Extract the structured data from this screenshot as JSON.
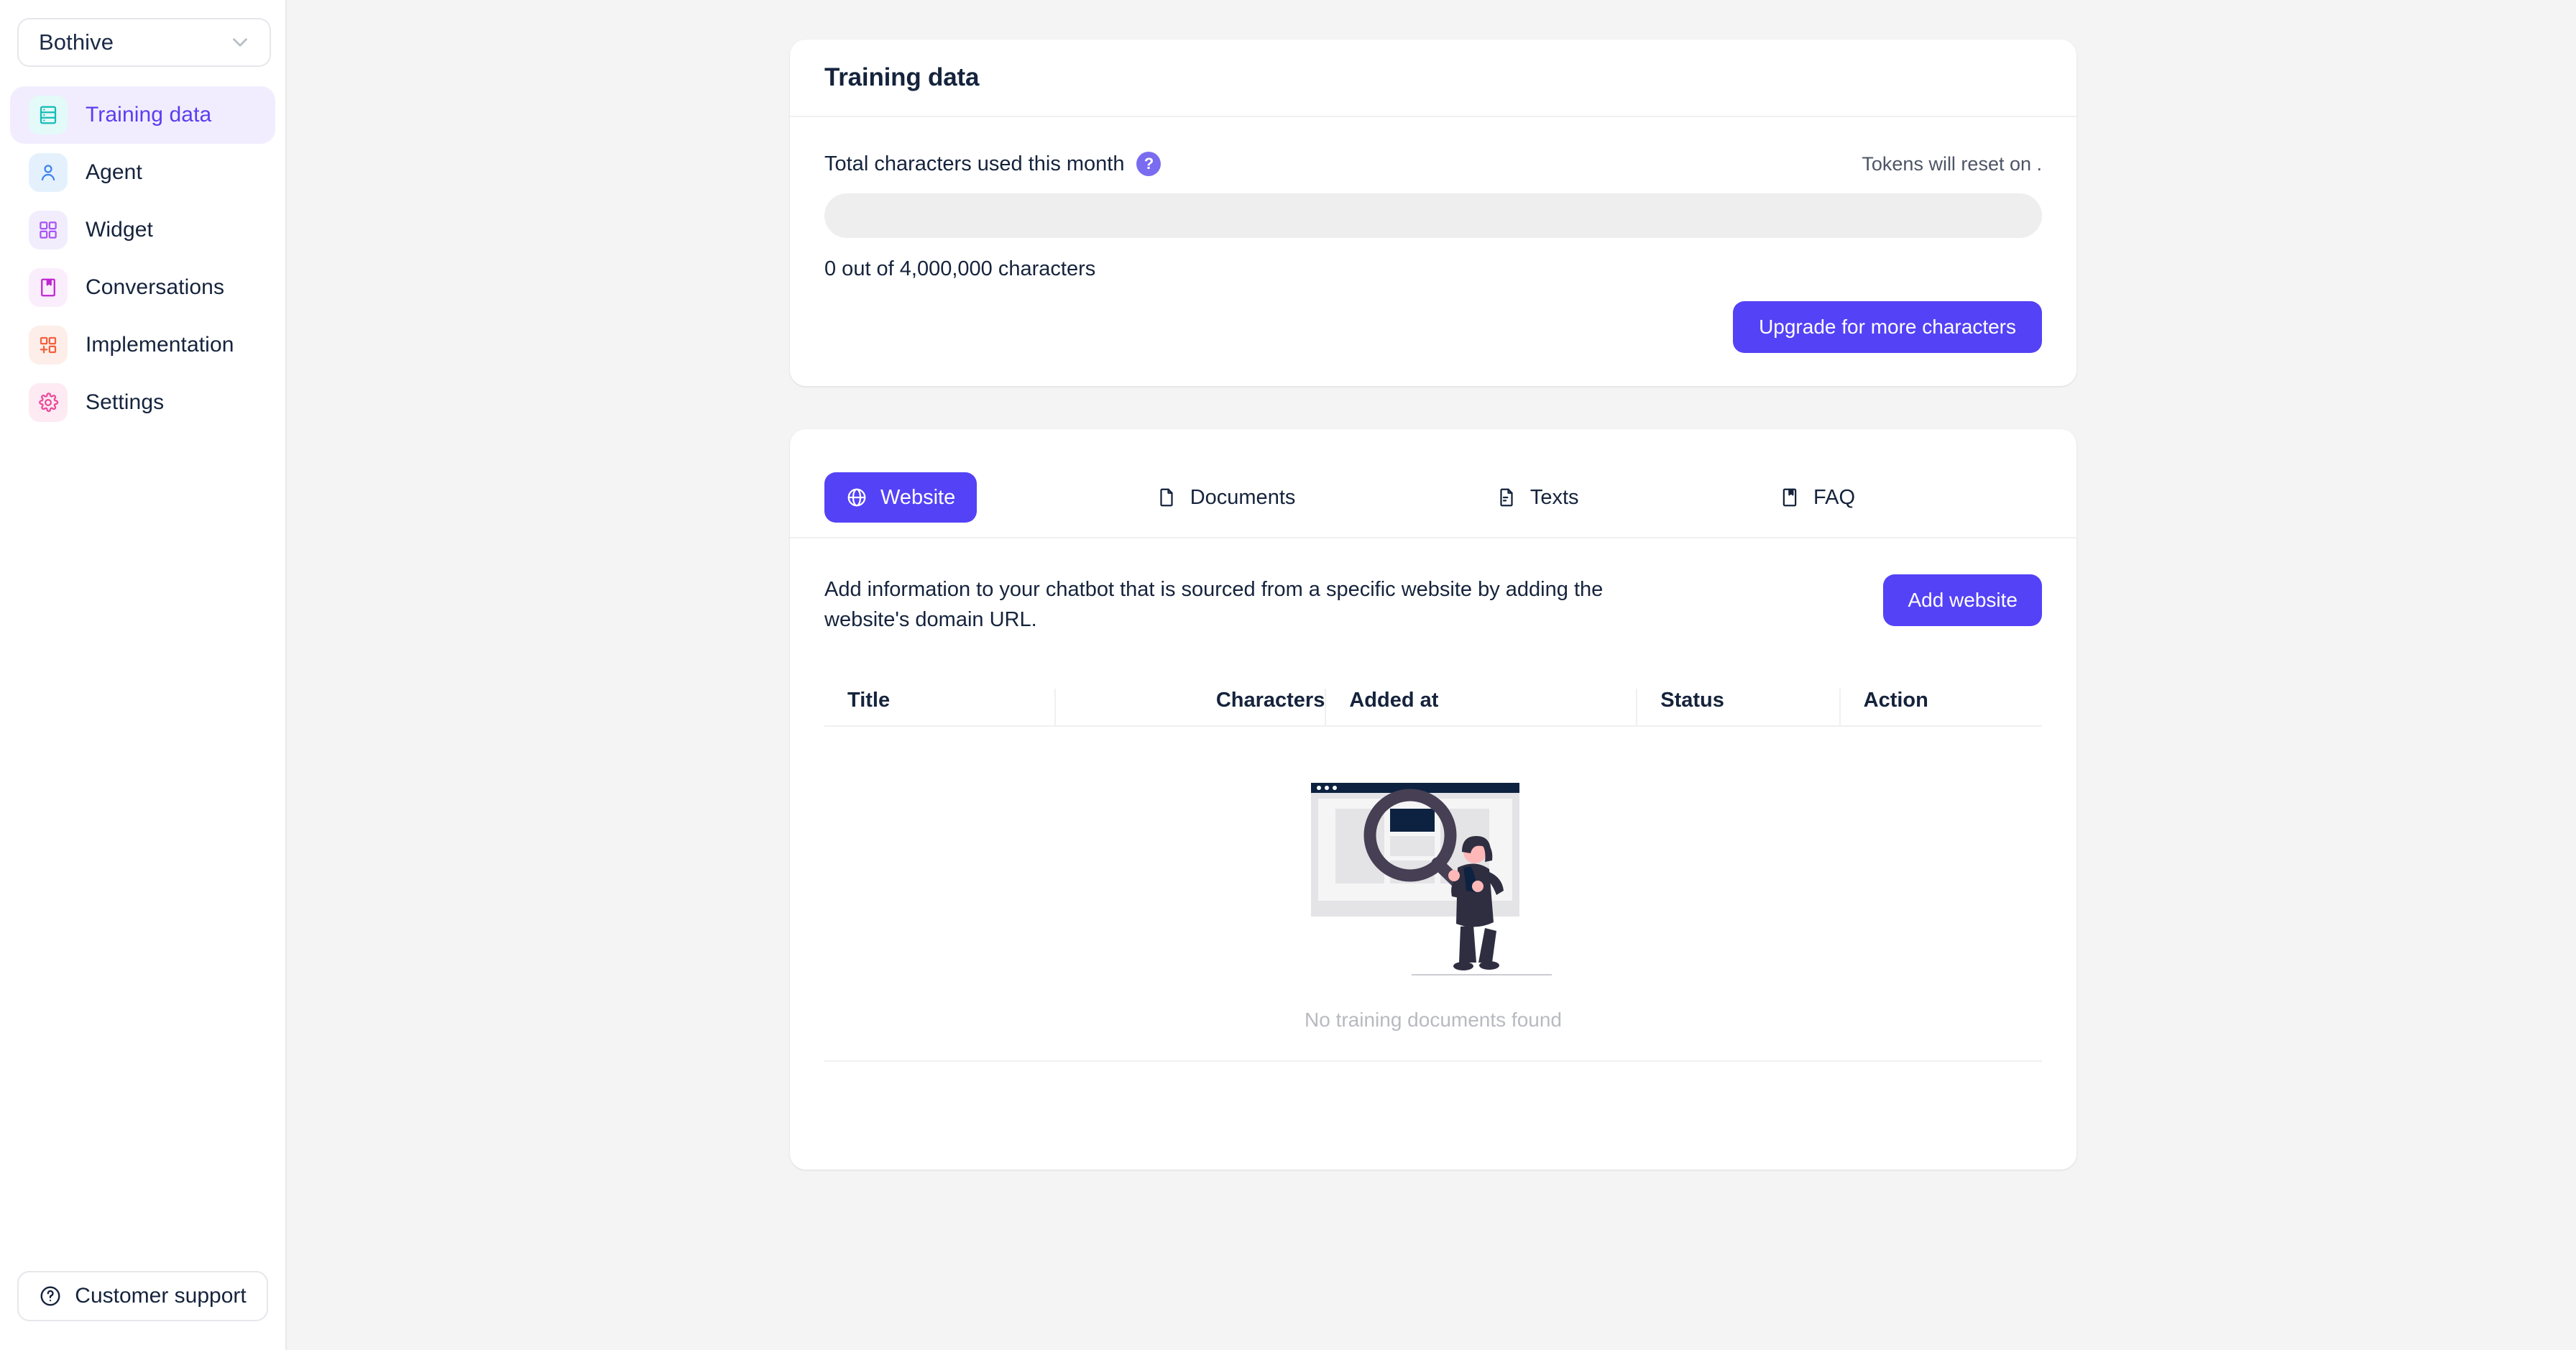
{
  "sidebar": {
    "org_selector": {
      "value": "Bothive",
      "icon": "chevron-down-icon"
    },
    "items": [
      {
        "label": "Training data",
        "icon": "database-icon",
        "active": true
      },
      {
        "label": "Agent",
        "icon": "user-icon",
        "active": false
      },
      {
        "label": "Widget",
        "icon": "grid-icon",
        "active": false
      },
      {
        "label": "Conversations",
        "icon": "book-icon",
        "active": false
      },
      {
        "label": "Implementation",
        "icon": "grid-plus-icon",
        "active": false
      },
      {
        "label": "Settings",
        "icon": "gear-icon",
        "active": false
      }
    ],
    "support": {
      "label": "Customer support",
      "icon": "question-circle-icon"
    }
  },
  "usage_card": {
    "title": "Training data",
    "usage_label": "Total characters used this month",
    "help_icon": "question-mark-icon",
    "help_glyph": "?",
    "reset_note": "Tokens will reset on .",
    "progress_percent": 0,
    "usage_count": "0 out of 4,000,000 characters",
    "upgrade_label": "Upgrade for more characters"
  },
  "sources_card": {
    "tabs": [
      {
        "label": "Website",
        "icon": "globe-icon",
        "active": true
      },
      {
        "label": "Documents",
        "icon": "file-icon",
        "active": false
      },
      {
        "label": "Texts",
        "icon": "file-text-icon",
        "active": false
      },
      {
        "label": "FAQ",
        "icon": "book-icon",
        "active": false
      }
    ],
    "description": "Add information to your chatbot that is sourced from a specific website by adding the website's domain URL.",
    "add_label": "Add website",
    "table": {
      "columns": [
        "Title",
        "Characters",
        "Added at",
        "Status",
        "Action"
      ],
      "rows": [],
      "empty_text": "No training documents found",
      "empty_illustration": "website-search-illustration"
    }
  },
  "colors": {
    "accent": "#5442f6",
    "accent_soft": "#f1edfe",
    "help_dot": "#7a6cf0",
    "page_bg": "#f4f4f5",
    "card_bg": "#ffffff",
    "text": "#15233c",
    "muted": "#b8babf"
  }
}
